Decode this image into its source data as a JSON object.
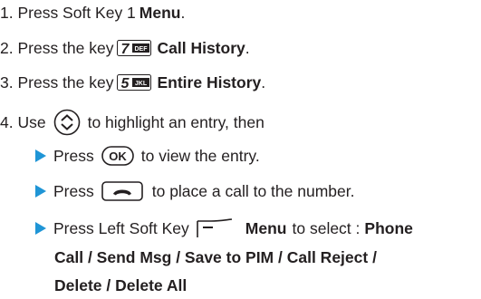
{
  "steps": {
    "s1_text": "1. Press Soft Key 1 ",
    "s1_bold": "Menu",
    "s1_end": ".",
    "s2_text": "2. Press the key",
    "s2_key": "7 DEF",
    "s2_bold": "Call History",
    "s2_end": ".",
    "s3_text": "3. Press the key",
    "s3_key": "5 JKL",
    "s3_bold": "Entire History",
    "s3_end": ".",
    "s4_pre": "4. Use",
    "s4_post": "to highlight an entry, then"
  },
  "bullets": {
    "b1_pre": "Press",
    "b1_key": "OK",
    "b1_post": "to view the entry.",
    "b2_pre": "Press",
    "b2_post": "to place a call to the number.",
    "b3_pre": "Press Left Soft Key",
    "b3_bold": "Menu",
    "b3_post": "to select :",
    "b3_line1_bold": "Phone",
    "b3_line2": "Call / Send Msg / Save to PIM / Call Reject /",
    "b3_line3": "Delete / Delete All"
  },
  "colors": {
    "text": "#231f20",
    "bullet_arrow": "#1f95d6"
  },
  "icons": [
    "key-7-def-icon",
    "key-5-jkl-icon",
    "nav-updown-icon",
    "ok-key-icon",
    "send-key-icon",
    "left-soft-key-icon"
  ]
}
